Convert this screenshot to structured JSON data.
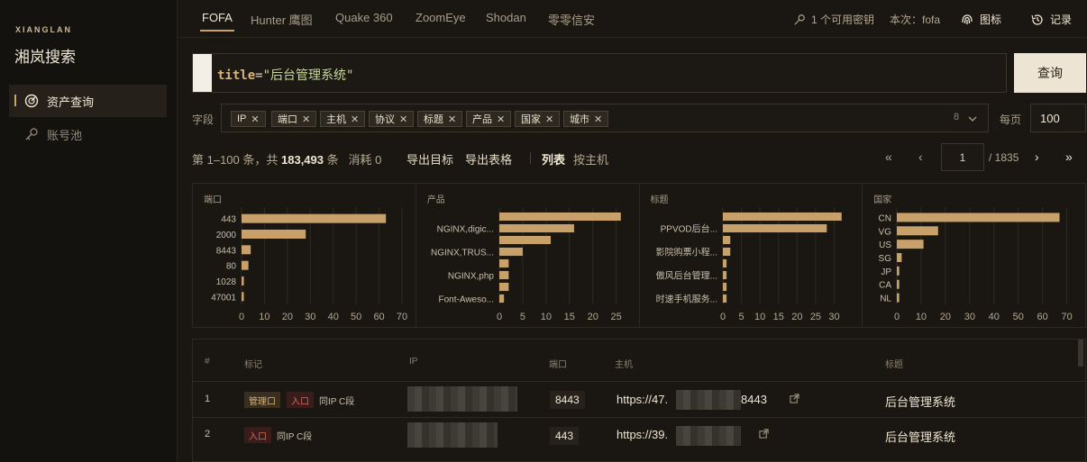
{
  "brand": {
    "en": "XIANGLAN",
    "cn": "湘岚搜索"
  },
  "sidebar": {
    "items": [
      {
        "label": "资产查询",
        "icon": "gauge-icon",
        "active": true
      },
      {
        "label": "账号池",
        "icon": "key-icon",
        "active": false
      }
    ]
  },
  "tabs": [
    {
      "label": "FOFA",
      "active": true
    },
    {
      "label": "Hunter 鹰图"
    },
    {
      "label": "Quake 360"
    },
    {
      "label": "ZoomEye"
    },
    {
      "label": "Shodan"
    },
    {
      "label": "零零信安"
    }
  ],
  "topright": {
    "keys": "1 个可用密钥",
    "current": "本次：fofa",
    "icons": "图标",
    "history": "记录"
  },
  "search": {
    "keyword": "title",
    "operator": "=",
    "value": "\"后台管理系统\"",
    "button": "查询"
  },
  "fields": {
    "label": "字段",
    "chips": [
      "IP",
      "端口",
      "主机",
      "协议",
      "标题",
      "产品",
      "国家",
      "城市"
    ],
    "count": "8",
    "per_page_label": "每页",
    "per_page": "100"
  },
  "stats": {
    "range": "第 1–100 条，共",
    "total": "183,493",
    "unit": "条",
    "cost": "消耗 0",
    "export_targets": "导出目标",
    "export_table": "导出表格",
    "view_list": "列表",
    "view_host": "按主机"
  },
  "pager": {
    "page": "1",
    "total": "/ 1835"
  },
  "chart_data": [
    {
      "type": "bar",
      "title": "端口",
      "categories": [
        "443",
        "2000",
        "8443",
        "80",
        "1028",
        "47001"
      ],
      "values": [
        63,
        28,
        4,
        3,
        1,
        1
      ],
      "xlim": [
        0,
        70
      ],
      "xticks": [
        "0",
        "10",
        "20",
        "30",
        "40",
        "50",
        "60",
        "70"
      ]
    },
    {
      "type": "bar",
      "title": "产品",
      "categories": [
        "",
        "NGINX,digic...",
        "",
        "NGINX,TRUS...",
        "",
        "NGINX,php",
        "",
        "Font-Aweso..."
      ],
      "values": [
        26,
        16,
        11,
        5,
        2,
        2,
        2,
        1
      ],
      "xlim": [
        0,
        27
      ],
      "xticks": [
        "0",
        "5",
        "10",
        "15",
        "20",
        "25"
      ]
    },
    {
      "type": "bar",
      "title": "标题",
      "categories": [
        "",
        "PPVOD后台...",
        "",
        "影院购票小程...",
        "",
        "傲风后台管理...",
        "",
        "时速手机服务..."
      ],
      "values": [
        32,
        28,
        2,
        2,
        1,
        1,
        1,
        1
      ],
      "xlim": [
        0,
        34
      ],
      "xticks": [
        "0",
        "5",
        "10",
        "15",
        "20",
        "25",
        "30"
      ]
    },
    {
      "type": "bar",
      "title": "国家",
      "categories": [
        "CN",
        "VG",
        "US",
        "SG",
        "JP",
        "CA",
        "NL"
      ],
      "values": [
        67,
        17,
        11,
        2,
        1,
        1,
        1
      ],
      "xlim": [
        0,
        72
      ],
      "xticks": [
        "0",
        "10",
        "20",
        "30",
        "40",
        "50",
        "60",
        "70"
      ]
    }
  ],
  "table": {
    "headers": {
      "idx": "#",
      "mark": "标记",
      "ip": "IP",
      "port": "端口",
      "host": "主机",
      "title": "标题"
    },
    "rows": [
      {
        "idx": "1",
        "tags": [
          "管理口",
          "入口"
        ],
        "note": "同IP C段",
        "port": "8443",
        "host_pre": "https://47.",
        "host_post": "8443",
        "title": "后台管理系统"
      },
      {
        "idx": "2",
        "tags": [
          "入口"
        ],
        "note": "同IP C段",
        "port": "443",
        "host_pre": "https://39.",
        "host_post": "",
        "title": "后台管理系统"
      }
    ]
  },
  "colors": {
    "accent": "#c9a36a",
    "bar": "#c7a06a",
    "background": "#1a1712"
  }
}
